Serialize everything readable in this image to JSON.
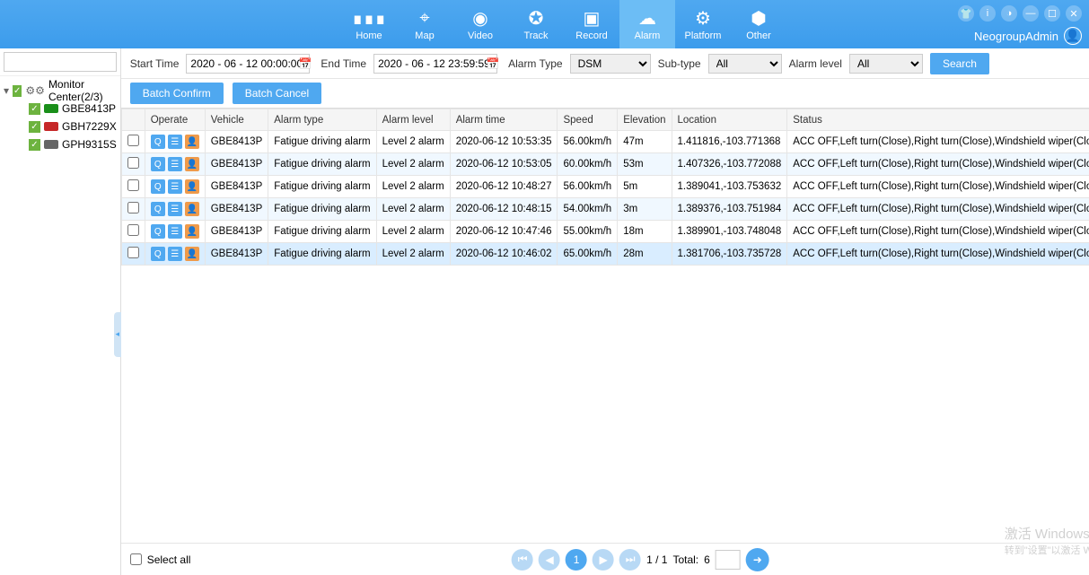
{
  "user": "NeogroupAdmin",
  "nav": [
    {
      "label": "Home"
    },
    {
      "label": "Map"
    },
    {
      "label": "Video"
    },
    {
      "label": "Track"
    },
    {
      "label": "Record"
    },
    {
      "label": "Alarm"
    },
    {
      "label": "Platform"
    },
    {
      "label": "Other"
    }
  ],
  "sidebar": {
    "root": "Monitor Center(2/3)",
    "items": [
      {
        "name": "GBE8413P",
        "color": "green"
      },
      {
        "name": "GBH7229X",
        "color": "red"
      },
      {
        "name": "GPH9315S",
        "color": "gray"
      }
    ]
  },
  "filters": {
    "start_label": "Start Time",
    "start_value": "2020 - 06 - 12 00:00:00",
    "end_label": "End Time",
    "end_value": "2020 - 06 - 12 23:59:59",
    "alarm_type_label": "Alarm Type",
    "alarm_type_value": "DSM",
    "sub_type_label": "Sub-type",
    "sub_type_value": "All",
    "alarm_level_label": "Alarm level",
    "alarm_level_value": "All",
    "search_btn": "Search",
    "batch_confirm": "Batch Confirm",
    "batch_cancel": "Batch Cancel"
  },
  "columns": [
    "Operate",
    "Vehicle",
    "Alarm type",
    "Alarm level",
    "Alarm time",
    "Speed",
    "Elevation",
    "Location",
    "Status"
  ],
  "rows": [
    {
      "vehicle": "GBE8413P",
      "type": "Fatigue driving alarm",
      "level": "Level 2 alarm",
      "time": "2020-06-12 10:53:35",
      "speed": "56.00km/h",
      "elev": "47m",
      "loc": "1.411816,-103.771368",
      "status": "ACC OFF,Left turn(Close),Right turn(Close),Windshield wiper(Close),Unbraked"
    },
    {
      "vehicle": "GBE8413P",
      "type": "Fatigue driving alarm",
      "level": "Level 2 alarm",
      "time": "2020-06-12 10:53:05",
      "speed": "60.00km/h",
      "elev": "53m",
      "loc": "1.407326,-103.772088",
      "status": "ACC OFF,Left turn(Close),Right turn(Close),Windshield wiper(Close),Unbraked"
    },
    {
      "vehicle": "GBE8413P",
      "type": "Fatigue driving alarm",
      "level": "Level 2 alarm",
      "time": "2020-06-12 10:48:27",
      "speed": "56.00km/h",
      "elev": "5m",
      "loc": "1.389041,-103.753632",
      "status": "ACC OFF,Left turn(Close),Right turn(Close),Windshield wiper(Close),Unbraked"
    },
    {
      "vehicle": "GBE8413P",
      "type": "Fatigue driving alarm",
      "level": "Level 2 alarm",
      "time": "2020-06-12 10:48:15",
      "speed": "54.00km/h",
      "elev": "3m",
      "loc": "1.389376,-103.751984",
      "status": "ACC OFF,Left turn(Close),Right turn(Close),Windshield wiper(Close),Unbraked"
    },
    {
      "vehicle": "GBE8413P",
      "type": "Fatigue driving alarm",
      "level": "Level 2 alarm",
      "time": "2020-06-12 10:47:46",
      "speed": "55.00km/h",
      "elev": "18m",
      "loc": "1.389901,-103.748048",
      "status": "ACC OFF,Left turn(Close),Right turn(Close),Windshield wiper(Close),Unbraked"
    },
    {
      "vehicle": "GBE8413P",
      "type": "Fatigue driving alarm",
      "level": "Level 2 alarm",
      "time": "2020-06-12 10:46:02",
      "speed": "65.00km/h",
      "elev": "28m",
      "loc": "1.381706,-103.735728",
      "status": "ACC OFF,Left turn(Close),Right turn(Close),Windshield wiper(Close),Unbraked"
    }
  ],
  "footer": {
    "select_all": "Select all",
    "page_info": "1  /  1",
    "total_label": "Total:",
    "total_value": "6"
  },
  "watermark": {
    "line1": "激活 Windows",
    "line2": "转到\"设置\"以激活 Windows。"
  }
}
